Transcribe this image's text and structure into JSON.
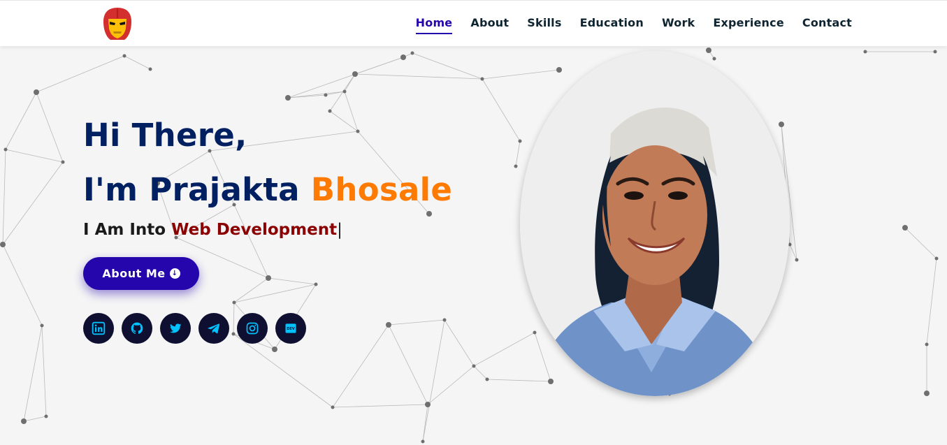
{
  "header": {
    "logo_icon": "iron-man-helmet-icon",
    "nav": [
      {
        "label": "Home",
        "active": true
      },
      {
        "label": "About",
        "active": false
      },
      {
        "label": "Skills",
        "active": false
      },
      {
        "label": "Education",
        "active": false
      },
      {
        "label": "Work",
        "active": false
      },
      {
        "label": "Experience",
        "active": false
      },
      {
        "label": "Contact",
        "active": false
      }
    ]
  },
  "hero": {
    "greeting_line1": "Hi There,",
    "greeting_prefix": "I'm Prajakta ",
    "greeting_highlight": "Bhosale",
    "typing_prefix": "I Am Into ",
    "typing_text": "Web Development",
    "typing_cursor": "|",
    "about_button": "About Me",
    "about_button_icon": "arrow-down-circle-icon"
  },
  "socials": [
    {
      "name": "linkedin-icon"
    },
    {
      "name": "github-icon"
    },
    {
      "name": "twitter-icon"
    },
    {
      "name": "telegram-icon"
    },
    {
      "name": "instagram-icon"
    },
    {
      "name": "dev-icon"
    }
  ],
  "colors": {
    "navy": "#012062",
    "orange": "#ff7a00",
    "accent_blue": "#2506ad",
    "dark_red": "#8b0000",
    "social_bg": "#0e0f31",
    "social_icon": "#00c2ff"
  },
  "portrait": {
    "description_icon": "profile-photo"
  }
}
